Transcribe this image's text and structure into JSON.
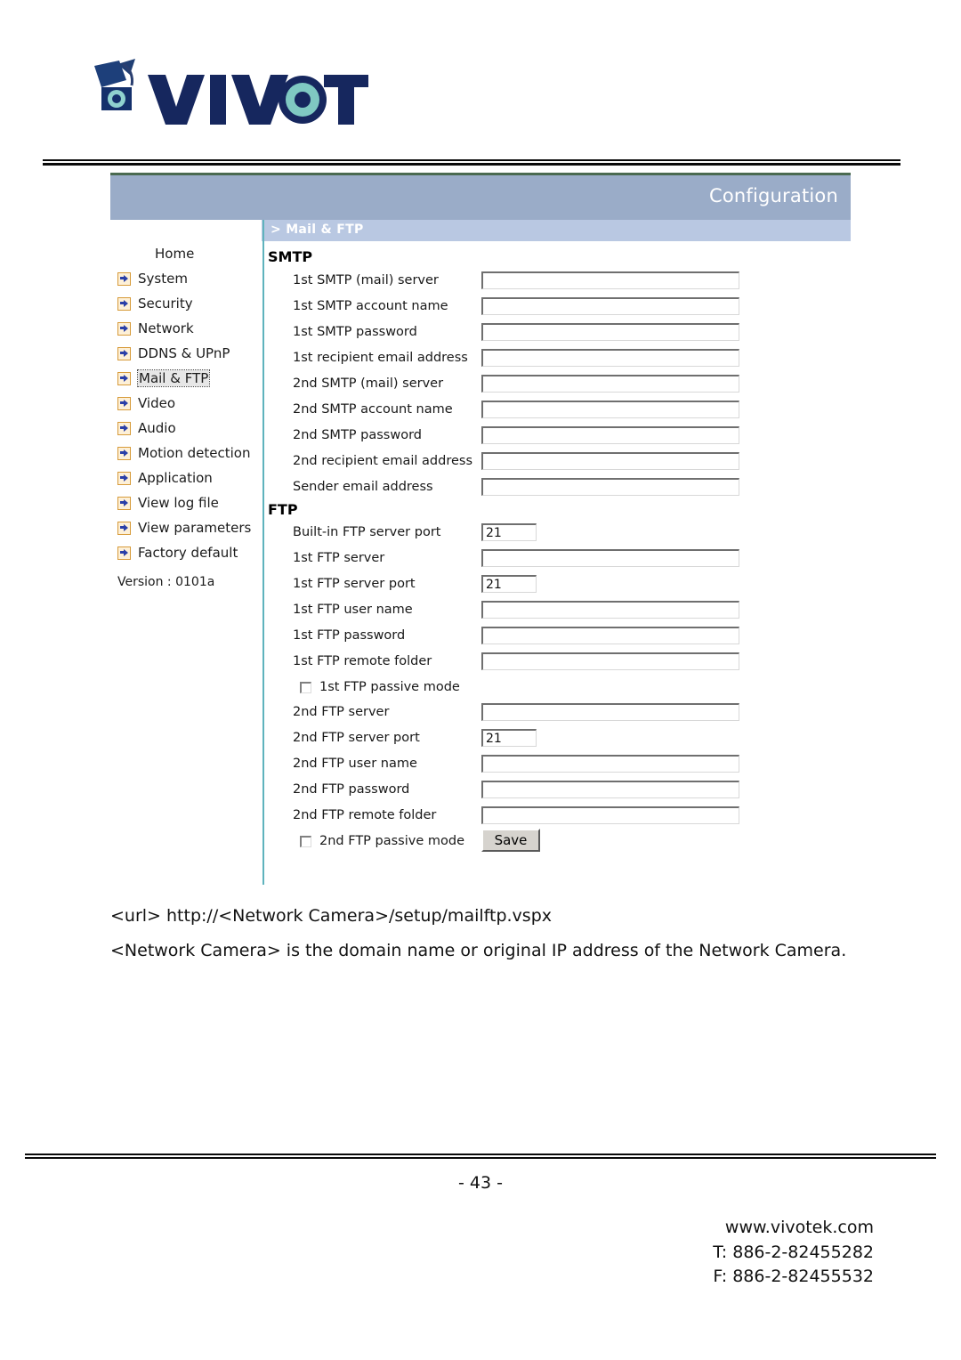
{
  "brand": {
    "logo_text": "VIVOTEK",
    "logo_icon": "vivotek-camera-logo"
  },
  "camera_ui": {
    "header": {
      "title": "Configuration",
      "breadcrumb": "> Mail & FTP"
    },
    "sidebar": {
      "items": [
        {
          "label": "Home",
          "icon": null,
          "selected": false
        },
        {
          "label": "System",
          "icon": "arrow-bullet-icon",
          "selected": false
        },
        {
          "label": "Security",
          "icon": "arrow-bullet-icon",
          "selected": false
        },
        {
          "label": "Network",
          "icon": "arrow-bullet-icon",
          "selected": false
        },
        {
          "label": "DDNS & UPnP",
          "icon": "arrow-bullet-icon",
          "selected": false
        },
        {
          "label": "Mail & FTP",
          "icon": "arrow-bullet-icon",
          "selected": true
        },
        {
          "label": "Video",
          "icon": "arrow-bullet-icon",
          "selected": false
        },
        {
          "label": "Audio",
          "icon": "arrow-bullet-icon",
          "selected": false
        },
        {
          "label": "Motion detection",
          "icon": "arrow-bullet-icon",
          "selected": false
        },
        {
          "label": "Application",
          "icon": "arrow-bullet-icon",
          "selected": false
        },
        {
          "label": "View log file",
          "icon": "arrow-bullet-icon",
          "selected": false
        },
        {
          "label": "View parameters",
          "icon": "arrow-bullet-icon",
          "selected": false
        },
        {
          "label": "Factory default",
          "icon": "arrow-bullet-icon",
          "selected": false
        }
      ],
      "version": "Version : 0101a"
    },
    "smtp": {
      "group_title": "SMTP",
      "fields": [
        {
          "label": "1st SMTP (mail) server",
          "value": "",
          "size": "wide"
        },
        {
          "label": "1st SMTP account name",
          "value": "",
          "size": "wide"
        },
        {
          "label": "1st SMTP password",
          "value": "",
          "size": "wide"
        },
        {
          "label": "1st recipient email address",
          "value": "",
          "size": "wide"
        },
        {
          "label": "2nd SMTP (mail) server",
          "value": "",
          "size": "wide"
        },
        {
          "label": "2nd SMTP account name",
          "value": "",
          "size": "wide"
        },
        {
          "label": "2nd SMTP password",
          "value": "",
          "size": "wide"
        },
        {
          "label": "2nd recipient email address",
          "value": "",
          "size": "wide"
        },
        {
          "label": "Sender email address",
          "value": "",
          "size": "wide"
        }
      ]
    },
    "ftp": {
      "group_title": "FTP",
      "fields": [
        {
          "label": "Built-in FTP server port",
          "value": "21",
          "size": "narrow"
        },
        {
          "label": "1st FTP server",
          "value": "",
          "size": "wide"
        },
        {
          "label": "1st FTP server port",
          "value": "21",
          "size": "narrow"
        },
        {
          "label": "1st FTP user name",
          "value": "",
          "size": "wide"
        },
        {
          "label": "1st FTP password",
          "value": "",
          "size": "wide"
        },
        {
          "label": "1st FTP remote folder",
          "value": "",
          "size": "wide"
        }
      ],
      "checkbox_1": {
        "label": "1st FTP passive mode",
        "checked": false
      },
      "fields2": [
        {
          "label": "2nd FTP server",
          "value": "",
          "size": "wide"
        },
        {
          "label": "2nd FTP server port",
          "value": "21",
          "size": "narrow"
        },
        {
          "label": "2nd FTP user name",
          "value": "",
          "size": "wide"
        },
        {
          "label": "2nd FTP password",
          "value": "",
          "size": "wide"
        },
        {
          "label": "2nd FTP remote folder",
          "value": "",
          "size": "wide"
        }
      ],
      "checkbox_2": {
        "label": "2nd FTP passive mode",
        "checked": false
      }
    },
    "save_button": "Save"
  },
  "document": {
    "url_line": "<url> http://<Network Camera>/setup/mailftp.vspx",
    "paragraph": "<Network Camera> is the domain name or original IP address of the Network Camera.",
    "page_number": "- 43 -",
    "footer": {
      "website": "www.vivotek.com",
      "tel": "T: 886-2-82455282",
      "fax": "F: 886-2-82455532"
    }
  },
  "colors": {
    "header_blue": "#9aacc8",
    "breadcrumb_blue": "#b9c8e2",
    "divider_teal": "#5fb3bd",
    "icon_orange": "#d79b3a",
    "icon_arrow_blue": "#2a3fa8",
    "top_green": "#4a6a50"
  }
}
